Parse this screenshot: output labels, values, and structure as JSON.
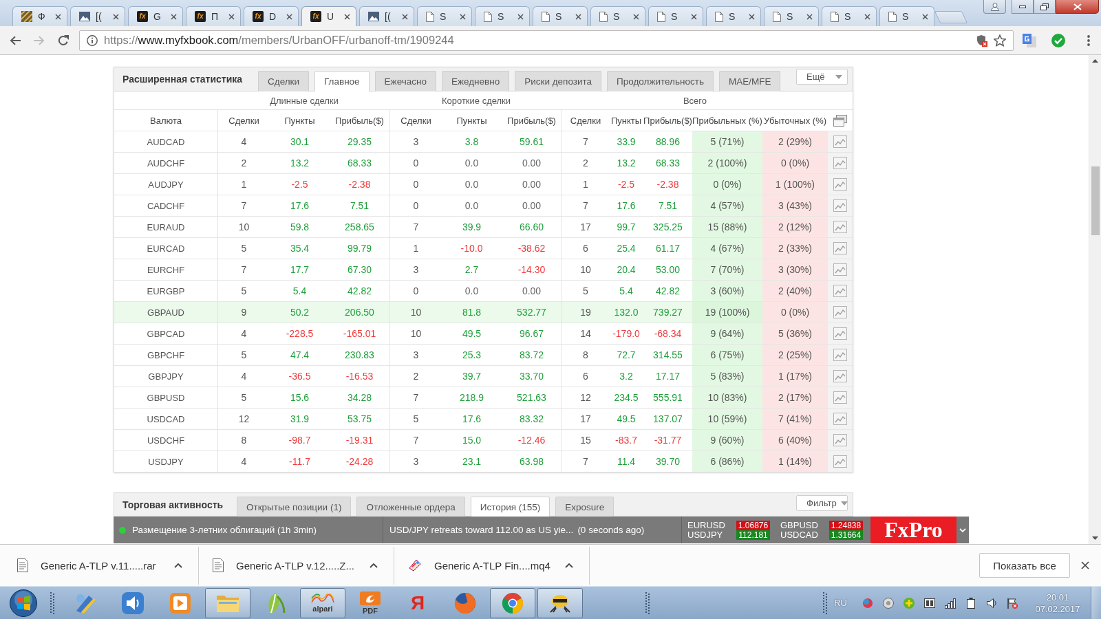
{
  "browser": {
    "tabs": [
      {
        "title": "Ф",
        "selected": false
      },
      {
        "title": "[(",
        "selected": false
      },
      {
        "title": "G",
        "selected": false,
        "favicon_text": "fx"
      },
      {
        "title": "П",
        "selected": false,
        "favicon_text": "fx"
      },
      {
        "title": "D",
        "selected": false,
        "favicon_text": "fx"
      },
      {
        "title": "U",
        "selected": true,
        "favicon_text": "fx"
      },
      {
        "title": "[(",
        "selected": false
      },
      {
        "title": "S",
        "selected": false
      },
      {
        "title": "S",
        "selected": false
      },
      {
        "title": "S",
        "selected": false
      },
      {
        "title": "S",
        "selected": false
      },
      {
        "title": "S",
        "selected": false
      },
      {
        "title": "S",
        "selected": false
      },
      {
        "title": "S",
        "selected": false
      },
      {
        "title": "S",
        "selected": false
      },
      {
        "title": "S",
        "selected": false
      }
    ],
    "address": {
      "scheme": "https://",
      "host": "www.myfxbook.com",
      "path": "/members/UrbanOFF/urbanoff-tm/1909244"
    }
  },
  "stats_panel": {
    "title": "Расширенная статистика",
    "tabs": [
      {
        "label": "Сделки",
        "selected": false
      },
      {
        "label": "Главное",
        "selected": true
      },
      {
        "label": "Ежечасно",
        "selected": false
      },
      {
        "label": "Ежедневно",
        "selected": false
      },
      {
        "label": "Риски депозита",
        "selected": false
      },
      {
        "label": "Продолжительность",
        "selected": false
      },
      {
        "label": "MAE/MFE",
        "selected": false
      }
    ],
    "more": "Ещё",
    "groups": [
      "Длинные сделки",
      "Короткие сделки",
      "Всего"
    ],
    "columns": [
      "Валюта",
      "Сделки",
      "Пункты",
      "Прибыль($)",
      "Сделки",
      "Пункты",
      "Прибыль($)",
      "Сделки",
      "Пункты",
      "Прибыль($)",
      "Прибыльных (%)",
      "Убыточных (%)"
    ],
    "rows": [
      {
        "currency": "AUDCAD",
        "highlighted": false,
        "long": {
          "trades": "4",
          "pips": {
            "text": "30.1",
            "color": "#1e9f3a"
          },
          "profit": {
            "text": "29.35",
            "color": "#1e9f3a"
          }
        },
        "short": {
          "trades": "3",
          "pips": {
            "text": "3.8",
            "color": "#1e9f3a"
          },
          "profit": {
            "text": "59.61",
            "color": "#1e9f3a"
          }
        },
        "total": {
          "trades": "7",
          "pips": {
            "text": "33.9",
            "color": "#1e9f3a"
          },
          "profit": {
            "text": "88.96",
            "color": "#1e9f3a"
          }
        },
        "won": "5 (71%)",
        "lost": "2 (29%)"
      },
      {
        "currency": "AUDCHF",
        "highlighted": false,
        "long": {
          "trades": "2",
          "pips": {
            "text": "13.2",
            "color": "#1e9f3a"
          },
          "profit": {
            "text": "68.33",
            "color": "#1e9f3a"
          }
        },
        "short": {
          "trades": "0",
          "pips": {
            "text": "0.0",
            "color": "#666666"
          },
          "profit": {
            "text": "0.00",
            "color": "#666666"
          }
        },
        "total": {
          "trades": "2",
          "pips": {
            "text": "13.2",
            "color": "#1e9f3a"
          },
          "profit": {
            "text": "68.33",
            "color": "#1e9f3a"
          }
        },
        "won": "2 (100%)",
        "lost": "0 (0%)"
      },
      {
        "currency": "AUDJPY",
        "highlighted": false,
        "long": {
          "trades": "1",
          "pips": {
            "text": "-2.5",
            "color": "#f0393b"
          },
          "profit": {
            "text": "-2.38",
            "color": "#f0393b"
          }
        },
        "short": {
          "trades": "0",
          "pips": {
            "text": "0.0",
            "color": "#666666"
          },
          "profit": {
            "text": "0.00",
            "color": "#666666"
          }
        },
        "total": {
          "trades": "1",
          "pips": {
            "text": "-2.5",
            "color": "#f0393b"
          },
          "profit": {
            "text": "-2.38",
            "color": "#f0393b"
          }
        },
        "won": "0 (0%)",
        "lost": "1 (100%)"
      },
      {
        "currency": "CADCHF",
        "highlighted": false,
        "long": {
          "trades": "7",
          "pips": {
            "text": "17.6",
            "color": "#1e9f3a"
          },
          "profit": {
            "text": "7.51",
            "color": "#1e9f3a"
          }
        },
        "short": {
          "trades": "0",
          "pips": {
            "text": "0.0",
            "color": "#666666"
          },
          "profit": {
            "text": "0.00",
            "color": "#666666"
          }
        },
        "total": {
          "trades": "7",
          "pips": {
            "text": "17.6",
            "color": "#1e9f3a"
          },
          "profit": {
            "text": "7.51",
            "color": "#1e9f3a"
          }
        },
        "won": "4 (57%)",
        "lost": "3 (43%)"
      },
      {
        "currency": "EURAUD",
        "highlighted": false,
        "long": {
          "trades": "10",
          "pips": {
            "text": "59.8",
            "color": "#1e9f3a"
          },
          "profit": {
            "text": "258.65",
            "color": "#1e9f3a"
          }
        },
        "short": {
          "trades": "7",
          "pips": {
            "text": "39.9",
            "color": "#1e9f3a"
          },
          "profit": {
            "text": "66.60",
            "color": "#1e9f3a"
          }
        },
        "total": {
          "trades": "17",
          "pips": {
            "text": "99.7",
            "color": "#1e9f3a"
          },
          "profit": {
            "text": "325.25",
            "color": "#1e9f3a"
          }
        },
        "won": "15 (88%)",
        "lost": "2 (12%)"
      },
      {
        "currency": "EURCAD",
        "highlighted": false,
        "long": {
          "trades": "5",
          "pips": {
            "text": "35.4",
            "color": "#1e9f3a"
          },
          "profit": {
            "text": "99.79",
            "color": "#1e9f3a"
          }
        },
        "short": {
          "trades": "1",
          "pips": {
            "text": "-10.0",
            "color": "#f0393b"
          },
          "profit": {
            "text": "-38.62",
            "color": "#f0393b"
          }
        },
        "total": {
          "trades": "6",
          "pips": {
            "text": "25.4",
            "color": "#1e9f3a"
          },
          "profit": {
            "text": "61.17",
            "color": "#1e9f3a"
          }
        },
        "won": "4 (67%)",
        "lost": "2 (33%)"
      },
      {
        "currency": "EURCHF",
        "highlighted": false,
        "long": {
          "trades": "7",
          "pips": {
            "text": "17.7",
            "color": "#1e9f3a"
          },
          "profit": {
            "text": "67.30",
            "color": "#1e9f3a"
          }
        },
        "short": {
          "trades": "3",
          "pips": {
            "text": "2.7",
            "color": "#1e9f3a"
          },
          "profit": {
            "text": "-14.30",
            "color": "#f0393b"
          }
        },
        "total": {
          "trades": "10",
          "pips": {
            "text": "20.4",
            "color": "#1e9f3a"
          },
          "profit": {
            "text": "53.00",
            "color": "#1e9f3a"
          }
        },
        "won": "7 (70%)",
        "lost": "3 (30%)"
      },
      {
        "currency": "EURGBP",
        "highlighted": false,
        "long": {
          "trades": "5",
          "pips": {
            "text": "5.4",
            "color": "#1e9f3a"
          },
          "profit": {
            "text": "42.82",
            "color": "#1e9f3a"
          }
        },
        "short": {
          "trades": "0",
          "pips": {
            "text": "0.0",
            "color": "#666666"
          },
          "profit": {
            "text": "0.00",
            "color": "#666666"
          }
        },
        "total": {
          "trades": "5",
          "pips": {
            "text": "5.4",
            "color": "#1e9f3a"
          },
          "profit": {
            "text": "42.82",
            "color": "#1e9f3a"
          }
        },
        "won": "3 (60%)",
        "lost": "2 (40%)"
      },
      {
        "currency": "GBPAUD",
        "highlighted": true,
        "long": {
          "trades": "9",
          "pips": {
            "text": "50.2",
            "color": "#1e9f3a"
          },
          "profit": {
            "text": "206.50",
            "color": "#1e9f3a"
          }
        },
        "short": {
          "trades": "10",
          "pips": {
            "text": "81.8",
            "color": "#1e9f3a"
          },
          "profit": {
            "text": "532.77",
            "color": "#1e9f3a"
          }
        },
        "total": {
          "trades": "19",
          "pips": {
            "text": "132.0",
            "color": "#1e9f3a"
          },
          "profit": {
            "text": "739.27",
            "color": "#1e9f3a"
          }
        },
        "won": "19 (100%)",
        "lost": "0 (0%)"
      },
      {
        "currency": "GBPCAD",
        "highlighted": false,
        "long": {
          "trades": "4",
          "pips": {
            "text": "-228.5",
            "color": "#f0393b"
          },
          "profit": {
            "text": "-165.01",
            "color": "#f0393b"
          }
        },
        "short": {
          "trades": "10",
          "pips": {
            "text": "49.5",
            "color": "#1e9f3a"
          },
          "profit": {
            "text": "96.67",
            "color": "#1e9f3a"
          }
        },
        "total": {
          "trades": "14",
          "pips": {
            "text": "-179.0",
            "color": "#f0393b"
          },
          "profit": {
            "text": "-68.34",
            "color": "#f0393b"
          }
        },
        "won": "9 (64%)",
        "lost": "5 (36%)"
      },
      {
        "currency": "GBPCHF",
        "highlighted": false,
        "long": {
          "trades": "5",
          "pips": {
            "text": "47.4",
            "color": "#1e9f3a"
          },
          "profit": {
            "text": "230.83",
            "color": "#1e9f3a"
          }
        },
        "short": {
          "trades": "3",
          "pips": {
            "text": "25.3",
            "color": "#1e9f3a"
          },
          "profit": {
            "text": "83.72",
            "color": "#1e9f3a"
          }
        },
        "total": {
          "trades": "8",
          "pips": {
            "text": "72.7",
            "color": "#1e9f3a"
          },
          "profit": {
            "text": "314.55",
            "color": "#1e9f3a"
          }
        },
        "won": "6 (75%)",
        "lost": "2 (25%)"
      },
      {
        "currency": "GBPJPY",
        "highlighted": false,
        "long": {
          "trades": "4",
          "pips": {
            "text": "-36.5",
            "color": "#f0393b"
          },
          "profit": {
            "text": "-16.53",
            "color": "#f0393b"
          }
        },
        "short": {
          "trades": "2",
          "pips": {
            "text": "39.7",
            "color": "#1e9f3a"
          },
          "profit": {
            "text": "33.70",
            "color": "#1e9f3a"
          }
        },
        "total": {
          "trades": "6",
          "pips": {
            "text": "3.2",
            "color": "#1e9f3a"
          },
          "profit": {
            "text": "17.17",
            "color": "#1e9f3a"
          }
        },
        "won": "5 (83%)",
        "lost": "1 (17%)"
      },
      {
        "currency": "GBPUSD",
        "highlighted": false,
        "long": {
          "trades": "5",
          "pips": {
            "text": "15.6",
            "color": "#1e9f3a"
          },
          "profit": {
            "text": "34.28",
            "color": "#1e9f3a"
          }
        },
        "short": {
          "trades": "7",
          "pips": {
            "text": "218.9",
            "color": "#1e9f3a"
          },
          "profit": {
            "text": "521.63",
            "color": "#1e9f3a"
          }
        },
        "total": {
          "trades": "12",
          "pips": {
            "text": "234.5",
            "color": "#1e9f3a"
          },
          "profit": {
            "text": "555.91",
            "color": "#1e9f3a"
          }
        },
        "won": "10 (83%)",
        "lost": "2 (17%)"
      },
      {
        "currency": "USDCAD",
        "highlighted": false,
        "long": {
          "trades": "12",
          "pips": {
            "text": "31.9",
            "color": "#1e9f3a"
          },
          "profit": {
            "text": "53.75",
            "color": "#1e9f3a"
          }
        },
        "short": {
          "trades": "5",
          "pips": {
            "text": "17.6",
            "color": "#1e9f3a"
          },
          "profit": {
            "text": "83.32",
            "color": "#1e9f3a"
          }
        },
        "total": {
          "trades": "17",
          "pips": {
            "text": "49.5",
            "color": "#1e9f3a"
          },
          "profit": {
            "text": "137.07",
            "color": "#1e9f3a"
          }
        },
        "won": "10 (59%)",
        "lost": "7 (41%)"
      },
      {
        "currency": "USDCHF",
        "highlighted": false,
        "long": {
          "trades": "8",
          "pips": {
            "text": "-98.7",
            "color": "#f0393b"
          },
          "profit": {
            "text": "-19.31",
            "color": "#f0393b"
          }
        },
        "short": {
          "trades": "7",
          "pips": {
            "text": "15.0",
            "color": "#1e9f3a"
          },
          "profit": {
            "text": "-12.46",
            "color": "#f0393b"
          }
        },
        "total": {
          "trades": "15",
          "pips": {
            "text": "-83.7",
            "color": "#f0393b"
          },
          "profit": {
            "text": "-31.77",
            "color": "#f0393b"
          }
        },
        "won": "9 (60%)",
        "lost": "6 (40%)"
      },
      {
        "currency": "USDJPY",
        "highlighted": false,
        "long": {
          "trades": "4",
          "pips": {
            "text": "-11.7",
            "color": "#f0393b"
          },
          "profit": {
            "text": "-24.28",
            "color": "#f0393b"
          }
        },
        "short": {
          "trades": "3",
          "pips": {
            "text": "23.1",
            "color": "#1e9f3a"
          },
          "profit": {
            "text": "63.98",
            "color": "#1e9f3a"
          }
        },
        "total": {
          "trades": "7",
          "pips": {
            "text": "11.4",
            "color": "#1e9f3a"
          },
          "profit": {
            "text": "39.70",
            "color": "#1e9f3a"
          }
        },
        "won": "6 (86%)",
        "lost": "1 (14%)"
      }
    ]
  },
  "activity_panel": {
    "title": "Торговая активность",
    "tabs": [
      {
        "label": "Открытые позиции (1)",
        "selected": false
      },
      {
        "label": "Отложенные ордера",
        "selected": false
      },
      {
        "label": "История (155)",
        "selected": true
      },
      {
        "label": "Exposure",
        "selected": false
      }
    ],
    "filter": "Фильтр"
  },
  "ticker": {
    "event": "Размещение 3-летних облигаций (1h 3min)",
    "headline": "USD/JPY retreats toward 112.00 as US yie...",
    "age": "(0 seconds ago)",
    "quotes": [
      {
        "pair": "EURUSD",
        "price": "1.06876",
        "color": "#d40f16"
      },
      {
        "pair": "USDJPY",
        "price": "112.181",
        "color": "#16891f"
      },
      {
        "pair": "GBPUSD",
        "price": "1.24838",
        "color": "#d40f16"
      },
      {
        "pair": "USDCAD",
        "price": "1.31664",
        "color": "#16891f"
      }
    ],
    "logo": "FxPro"
  },
  "downloads": {
    "items": [
      {
        "name": "Generic A-TLP v.11.....rar"
      },
      {
        "name": "Generic A-TLP v.12.....Z..."
      },
      {
        "name": "Generic A-TLP Fin....mq4"
      }
    ],
    "show_all": "Показать все"
  },
  "taskbar": {
    "apps": [
      {
        "open": false
      },
      {
        "open": false
      },
      {
        "open": false
      },
      {
        "open": true
      },
      {
        "open": false
      },
      {
        "open": true,
        "label": "alpari"
      },
      {
        "open": false,
        "label": "PDF"
      },
      {
        "open": false,
        "label": "Я"
      },
      {
        "open": false
      },
      {
        "open": true
      },
      {
        "open": true
      }
    ],
    "language": "RU",
    "time": "20:01",
    "date": "07.02.2017"
  }
}
